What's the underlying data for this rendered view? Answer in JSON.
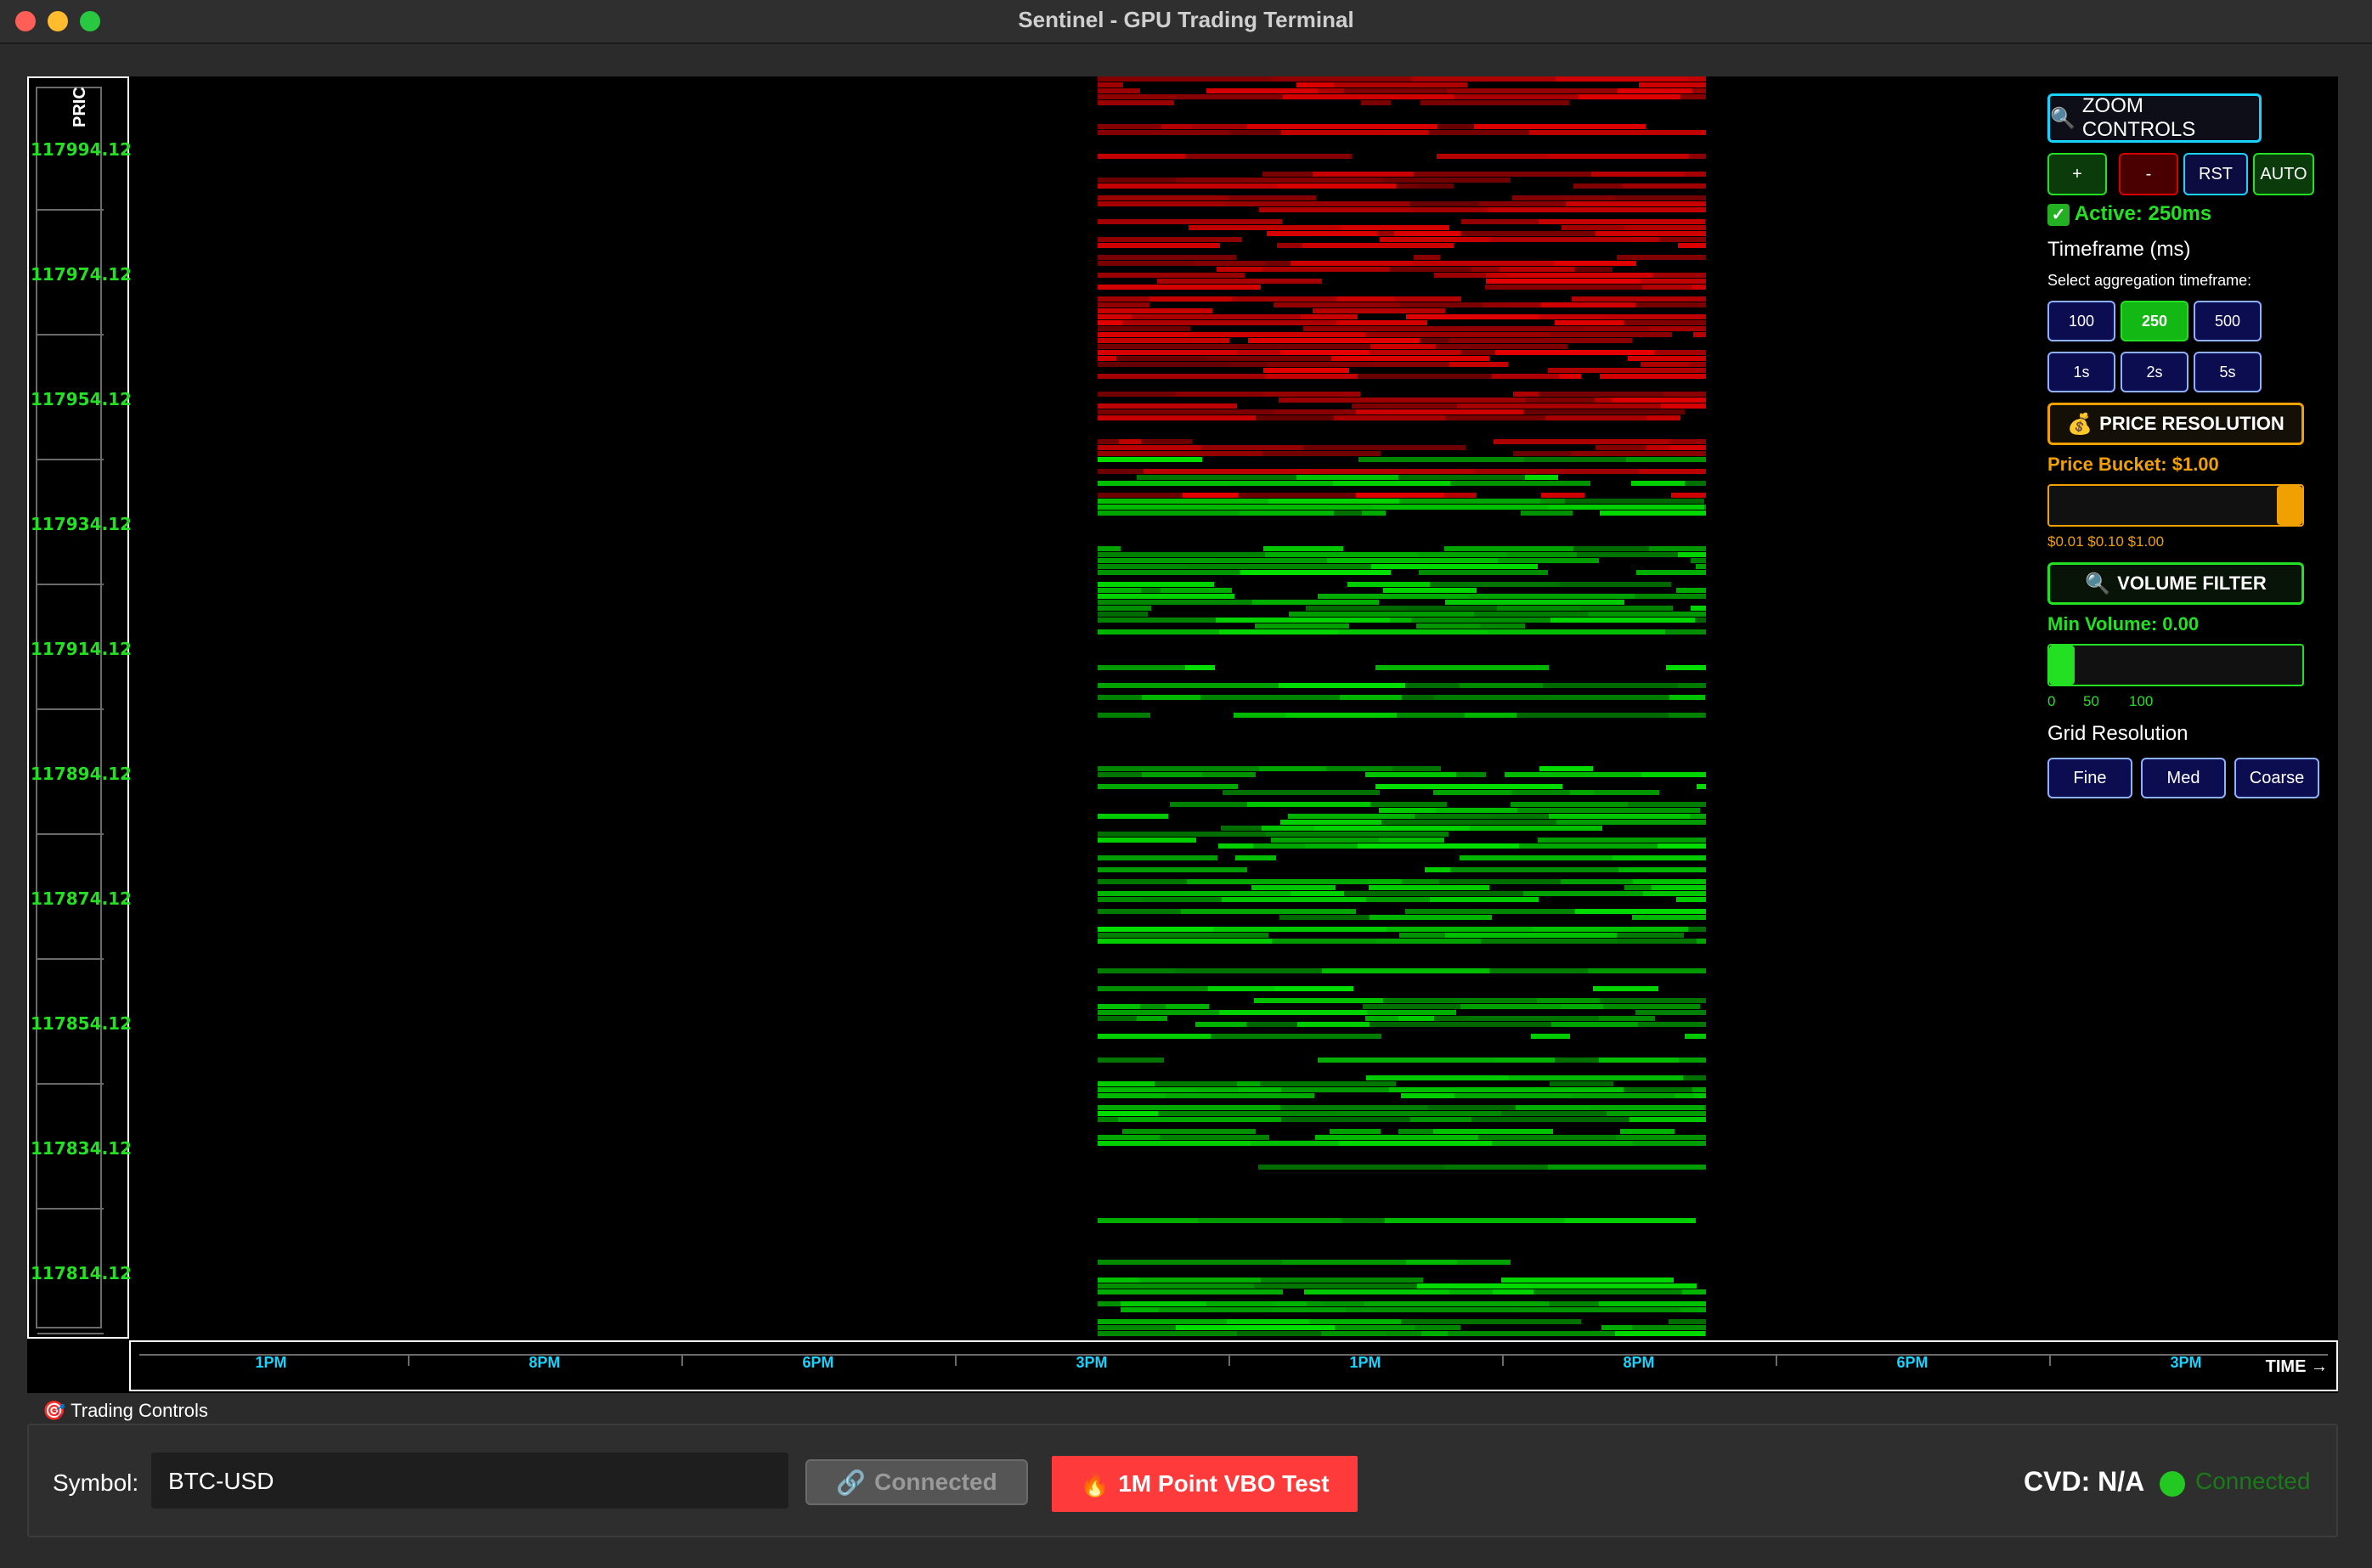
{
  "window": {
    "title": "Sentinel - GPU Trading Terminal"
  },
  "colors": {
    "accent_green": "#23e023",
    "accent_cyan": "#19d3ff",
    "accent_orange": "#f0a000",
    "bid_red": "#d40000",
    "ask_green": "#14c814"
  },
  "chart": {
    "y_axis_title": "PRIC",
    "price_labels": [
      "117994.12",
      "117974.12",
      "117954.12",
      "117934.12",
      "117914.12",
      "117894.12",
      "117874.12",
      "117854.12",
      "117834.12",
      "117814.12"
    ],
    "time_labels": [
      "1PM",
      "8PM",
      "6PM",
      "3PM",
      "1PM",
      "8PM",
      "6PM",
      "3PM"
    ],
    "x_axis_title": "TIME →"
  },
  "controls": {
    "zoom_title": "ZOOM CONTROLS",
    "zoom_in": "+",
    "zoom_out": "-",
    "reset": "RST",
    "auto": "AUTO",
    "active_status": "Active: 250ms",
    "timeframe_title": "Timeframe (ms)",
    "timeframe_hint": "Select aggregation timeframe:",
    "timeframes": [
      "100",
      "250",
      "500",
      "1s",
      "2s",
      "5s"
    ],
    "timeframe_selected": "250",
    "price_resolution_title": "PRICE RESOLUTION",
    "price_bucket_label": "Price Bucket: $1.00",
    "price_bucket_value": 1.0,
    "price_bucket_scale": "$0.01 $0.10 $1.00",
    "volume_filter_title": "VOLUME FILTER",
    "min_volume_label": "Min Volume: 0.00",
    "min_volume_value": 0,
    "volume_scale": [
      "0",
      "50",
      "100"
    ],
    "grid_title": "Grid Resolution",
    "grid_options": [
      "Fine",
      "Med",
      "Coarse"
    ]
  },
  "trading": {
    "section_title": "Trading Controls",
    "symbol_label": "Symbol:",
    "symbol_value": "BTC-USD",
    "connect_button": "Connected",
    "test_button": "1M Point VBO Test",
    "cvd": "CVD: N/A",
    "status": "Connected"
  }
}
